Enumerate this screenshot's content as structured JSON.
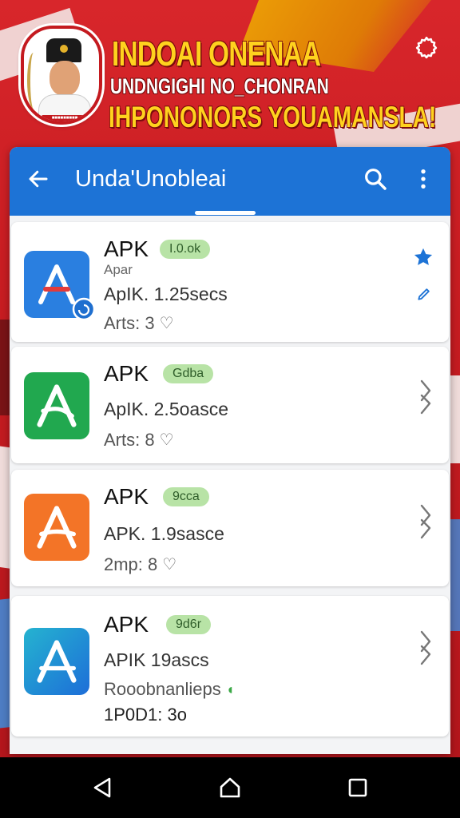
{
  "banner": {
    "title": "INDOAI ONENAA",
    "subtitle": "UNDNGIGHI NO_CHONRAN",
    "tagline": "IHPONONORS YOUAMANSLA!",
    "emblem_caption": "■■■■■■■■■"
  },
  "app_bar": {
    "title": "Unda'Unobleai"
  },
  "apps": [
    {
      "name": "APK",
      "badge": "I.0.ok",
      "developer": "Apar",
      "size": "ApIK. 1.25secs",
      "meta": "Arts: 3",
      "icon_color": "#2a7fe0"
    },
    {
      "name": "APK",
      "badge": "Gdba",
      "size": "ApIK. 2.5oasce",
      "meta": "Arts: 8",
      "icon_color": "#21a84f"
    },
    {
      "name": "APK",
      "badge": "9cca",
      "size": "APK. 1.9sasce",
      "meta": "2mp: 8",
      "icon_color": "#f37427"
    },
    {
      "name": "APK",
      "badge": "9d6r",
      "size": "APIK 19ascs",
      "meta": "Rooobnanlieps",
      "meta2": "1P0D1: 3o",
      "icon_color": "#1d9bd6"
    }
  ],
  "colors": {
    "app_bar": "#1d73d6",
    "badge_bg": "#b8e3a6",
    "background_red": "#c41a1f",
    "banner_yellow": "#ffd21e"
  }
}
